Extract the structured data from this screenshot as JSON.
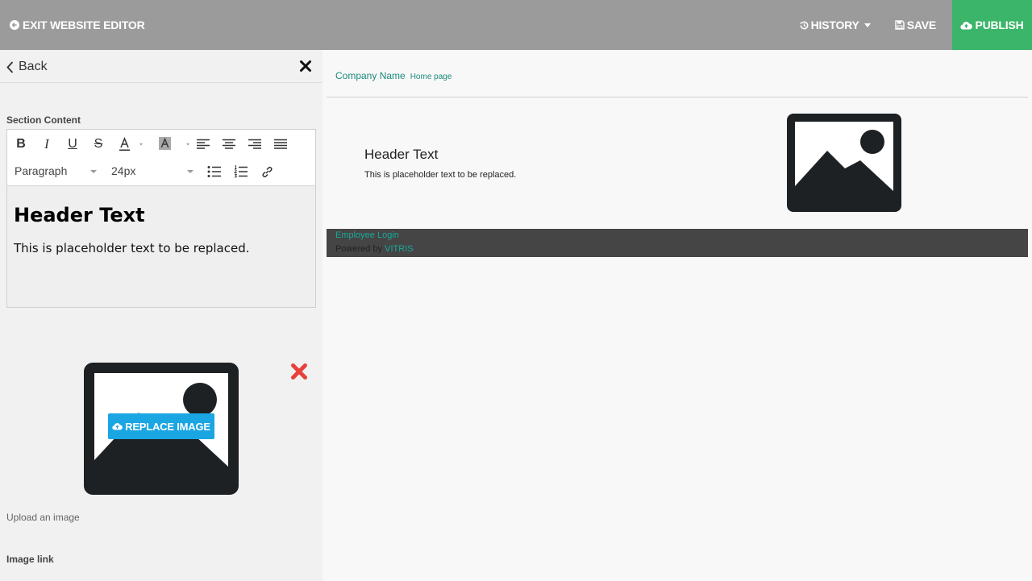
{
  "topbar": {
    "exit_label": "EXIT WEBSITE EDITOR",
    "history_label": "HISTORY",
    "save_label": "SAVE",
    "publish_label": "PUBLISH"
  },
  "left_panel": {
    "back_label": "Back",
    "section_label": "Section Content",
    "toolbar": {
      "block_format": "Paragraph",
      "font_size": "24px"
    },
    "content": {
      "heading": "Header Text",
      "paragraph": "This is placeholder text to be replaced."
    },
    "replace_image_label": "REPLACE IMAGE",
    "upload_label": "Upload an image",
    "image_link_label": "Image link"
  },
  "preview": {
    "company_name": "Company Name",
    "page_name": "Home page",
    "header_text": "Header Text",
    "body_text": "This is placeholder text to be replaced.",
    "footer": {
      "login_label": "Employee Login",
      "powered_prefix": "Powered by ",
      "powered_brand": "VITRIS"
    }
  },
  "colors": {
    "topbar_bg": "#9b9b9b",
    "publish_bg": "#3bb56a",
    "replace_btn_bg": "#1aa5e3",
    "remove_icon": "#e8413c",
    "link_teal": "#1a8a7a",
    "footer_bg": "#454545"
  },
  "icons": [
    "exit-arrow-icon",
    "history-icon",
    "save-disk-icon",
    "cloud-upload-icon",
    "chevron-left-icon",
    "close-icon",
    "image-placeholder-icon",
    "remove-x-icon"
  ]
}
